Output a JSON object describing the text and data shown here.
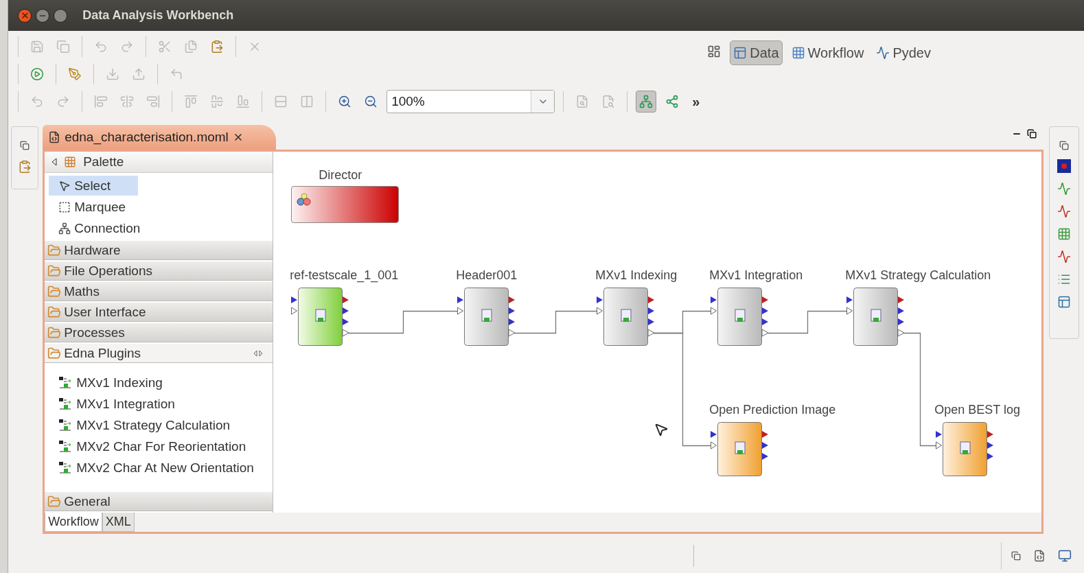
{
  "window": {
    "title": "Data Analysis Workbench"
  },
  "toolbar": {
    "zoom": "100%",
    "overflow": "»",
    "layout_toggles": [
      {
        "selected": true
      },
      {
        "selected": false
      }
    ]
  },
  "perspectives": [
    {
      "label": "Data",
      "selected": true
    },
    {
      "label": "Workflow",
      "selected": false
    },
    {
      "label": "Pydev",
      "selected": false
    }
  ],
  "editor": {
    "tab": "edna_characterisation.moml",
    "palette": {
      "title": "Palette",
      "tools": [
        {
          "label": "Select",
          "kind": "select",
          "selected": true
        },
        {
          "label": "Marquee",
          "kind": "marquee",
          "selected": false
        },
        {
          "label": "Connection",
          "kind": "connection",
          "selected": false
        }
      ],
      "drawers": [
        {
          "label": "Hardware",
          "expanded": false
        },
        {
          "label": "File Operations",
          "expanded": false
        },
        {
          "label": "Maths",
          "expanded": false
        },
        {
          "label": "User Interface",
          "expanded": false
        },
        {
          "label": "Processes",
          "expanded": false
        },
        {
          "label": "Edna Plugins",
          "expanded": true,
          "items": [
            "MXv1 Indexing",
            "MXv1 Integration",
            "MXv1 Strategy Calculation",
            "MXv2 Char For Reorientation",
            "MXv2 Char At New Orientation"
          ]
        },
        {
          "label": "General",
          "expanded": false
        }
      ]
    },
    "canvas": {
      "director": "Director",
      "nodes": [
        {
          "label": "ref-testscale_1_001",
          "kind": "source"
        },
        {
          "label": "Header001",
          "kind": "actor"
        },
        {
          "label": "MXv1 Indexing",
          "kind": "actor"
        },
        {
          "label": "MXv1 Integration",
          "kind": "actor"
        },
        {
          "label": "MXv1 Strategy Calculation",
          "kind": "actor"
        },
        {
          "label": "Open Prediction Image",
          "kind": "viewer"
        },
        {
          "label": "Open BEST log",
          "kind": "viewer"
        }
      ]
    },
    "bottom_tabs": [
      {
        "label": "Workflow",
        "selected": true
      },
      {
        "label": "XML",
        "selected": false
      }
    ]
  }
}
